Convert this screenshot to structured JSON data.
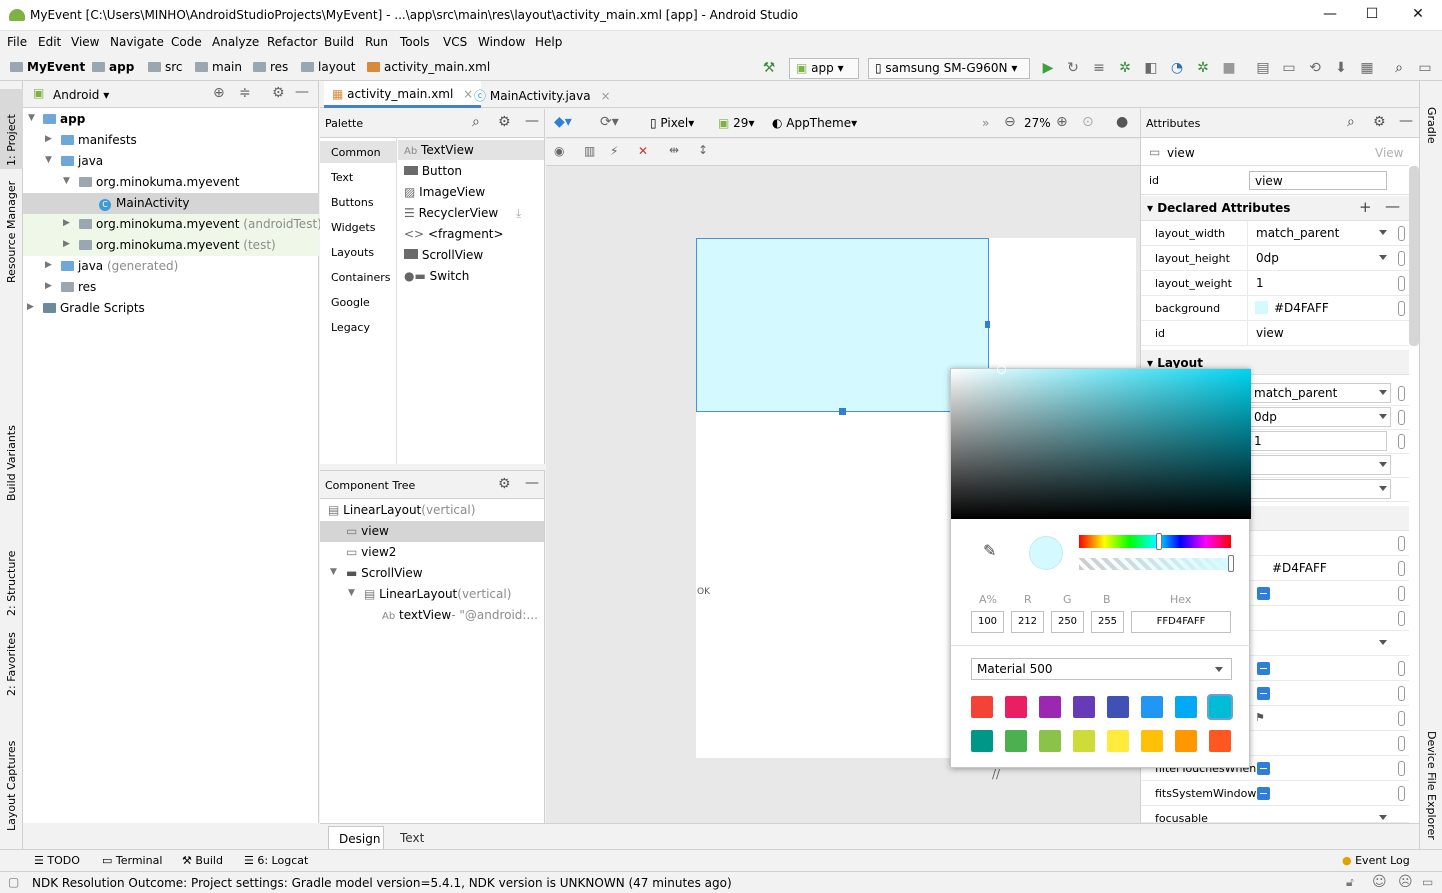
{
  "window": {
    "title": "MyEvent [C:\\Users\\MINHO\\AndroidStudioProjects\\MyEvent] - ...\\app\\src\\main\\res\\layout\\activity_main.xml [app] - Android Studio"
  },
  "menu": [
    "File",
    "Edit",
    "View",
    "Navigate",
    "Code",
    "Analyze",
    "Refactor",
    "Build",
    "Run",
    "Tools",
    "VCS",
    "Window",
    "Help"
  ],
  "breadcrumb": [
    "MyEvent",
    "app",
    "src",
    "main",
    "res",
    "layout",
    "activity_main.xml"
  ],
  "toolbar": {
    "run_config": "app",
    "device": "samsung SM-G960N"
  },
  "left_strip": [
    "1: Project",
    "Resource Manager",
    "Build Variants",
    "2: Structure",
    "2: Favorites",
    "Layout Captures"
  ],
  "right_strip": [
    "Gradle",
    "Device File Explorer"
  ],
  "project": {
    "view_mode": "Android",
    "tree": [
      {
        "label": "app",
        "suffix": ""
      },
      {
        "label": "manifests",
        "suffix": ""
      },
      {
        "label": "java",
        "suffix": ""
      },
      {
        "label": "org.minokuma.myevent",
        "suffix": ""
      },
      {
        "label": "MainActivity",
        "suffix": ""
      },
      {
        "label": "org.minokuma.myevent",
        "suffix": " (androidTest)"
      },
      {
        "label": "org.minokuma.myevent",
        "suffix": " (test)"
      },
      {
        "label": "java",
        "suffix": " (generated)"
      },
      {
        "label": "res",
        "suffix": ""
      },
      {
        "label": "Gradle Scripts",
        "suffix": ""
      }
    ]
  },
  "editor_tabs": [
    "activity_main.xml",
    "MainActivity.java"
  ],
  "palette": {
    "title": "Palette",
    "categories": [
      "Common",
      "Text",
      "Buttons",
      "Widgets",
      "Layouts",
      "Containers",
      "Google",
      "Legacy"
    ],
    "items": [
      "TextView",
      "Button",
      "ImageView",
      "RecyclerView",
      "<fragment>",
      "ScrollView",
      "Switch"
    ]
  },
  "design_toolbar": {
    "device": "Pixel",
    "api": "29",
    "theme": "AppTheme",
    "zoom": "27%"
  },
  "component_tree": {
    "title": "Component Tree",
    "rows": [
      {
        "label": "LinearLayout",
        "hint": "(vertical)"
      },
      {
        "label": "view",
        "hint": ""
      },
      {
        "label": "view2",
        "hint": ""
      },
      {
        "label": "ScrollView",
        "hint": ""
      },
      {
        "label": "LinearLayout",
        "hint": "(vertical)"
      },
      {
        "label": "textView",
        "hint": "- \"@android:..."
      }
    ]
  },
  "canvas": {
    "ok_text": "OK",
    "view_color": "#D4FAFF"
  },
  "attributes": {
    "title": "Attributes",
    "view_name": "view",
    "view_class": "View",
    "id_label": "id",
    "id_value": "view",
    "declared_title": "Declared Attributes",
    "declared": [
      {
        "key": "layout_width",
        "value": "match_parent"
      },
      {
        "key": "layout_height",
        "value": "0dp"
      },
      {
        "key": "layout_weight",
        "value": "1"
      },
      {
        "key": "background",
        "value": "#D4FAFF"
      },
      {
        "key": "id",
        "value": "view"
      }
    ],
    "layout_title": "Layout",
    "layout_values": [
      "match_parent",
      "0dp",
      "1"
    ],
    "lower_bg_value": "#D4FAFF",
    "lower_keys": [
      "filterTouchesWhen",
      "fitsSystemWindow",
      "focusable"
    ]
  },
  "color_picker": {
    "labels": {
      "a": "A%",
      "r": "R",
      "g": "G",
      "b": "B",
      "hex": "Hex"
    },
    "values": {
      "a": "100",
      "r": "212",
      "g": "250",
      "b": "255",
      "hex": "FFD4FAFF"
    },
    "palette_name": "Material 500",
    "swatches_row1": [
      "#F44336",
      "#E91E63",
      "#9C27B0",
      "#673AB7",
      "#3F51B5",
      "#2196F3",
      "#03A9F4",
      "#00BCD4"
    ],
    "swatches_row2": [
      "#009688",
      "#4CAF50",
      "#8BC34A",
      "#CDDC39",
      "#FFEB3B",
      "#FFC107",
      "#FF9800",
      "#FF5722"
    ]
  },
  "bottom_tabs": [
    "Design",
    "Text"
  ],
  "tool_windows": [
    "TODO",
    "Terminal",
    "Build",
    "6: Logcat"
  ],
  "event_log": "Event Log",
  "status": "NDK Resolution Outcome: Project settings: Gradle model version=5.4.1, NDK version is UNKNOWN (47 minutes ago)"
}
